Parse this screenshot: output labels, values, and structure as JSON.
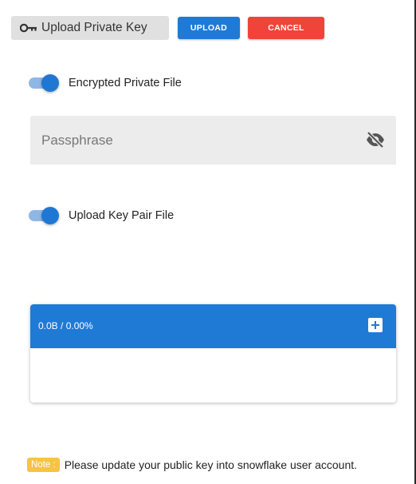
{
  "toolbar": {
    "upload_key_label": "Upload Private Key",
    "upload_label": "UPLOAD",
    "cancel_label": "CANCEL"
  },
  "encrypted_toggle": {
    "label": "Encrypted Private File",
    "on": true
  },
  "passphrase": {
    "placeholder": "Passphrase",
    "value": ""
  },
  "key_pair_toggle": {
    "label": "Upload Key Pair File",
    "on": true
  },
  "uploader": {
    "status": "0.0B / 0.00%",
    "progress_percent": 0
  },
  "note": {
    "badge": "Note :",
    "text": "Please update your public key into snowflake user account."
  },
  "colors": {
    "primary": "#1f7ad6",
    "danger": "#f0443a",
    "toggle_track": "#8fb7e6",
    "note_badge": "#f6c343",
    "field_background": "#ececec"
  },
  "icons": {
    "upload_key": "key-icon",
    "passphrase_visibility": "eye-off-icon",
    "add_file": "plus-square-icon"
  }
}
